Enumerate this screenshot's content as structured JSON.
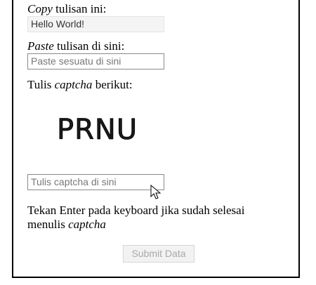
{
  "copy_section": {
    "label_italic": "Copy",
    "label_rest": " tulisan ini:",
    "value": "Hello World!"
  },
  "paste_section": {
    "label_italic": "Paste",
    "label_rest": " tulisan di sini:",
    "placeholder": "Paste sesuatu di sini"
  },
  "captcha_section": {
    "label_prefix": "Tulis ",
    "label_italic": "captcha",
    "label_suffix": " berikut:",
    "image_text": "PRNU",
    "input_placeholder": "Tulis captcha di sini"
  },
  "note": {
    "text": "Tekan Enter pada keyboard jika sudah selesai menulis ",
    "italic": "captcha"
  },
  "submit": {
    "label": "Submit Data"
  },
  "icons": {
    "cursor": "mouse-pointer-icon"
  }
}
